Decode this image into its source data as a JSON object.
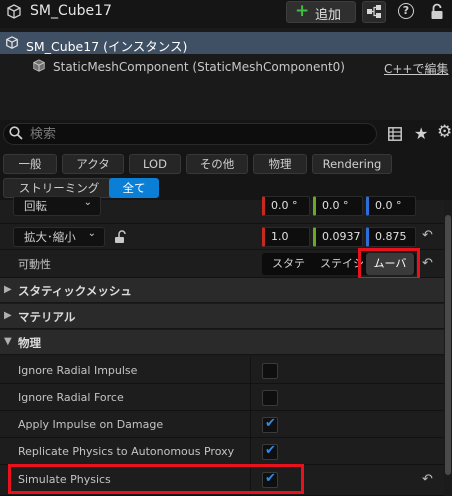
{
  "header": {
    "actor_name": "SM_Cube17",
    "add_label": "追加",
    "help_label": "?"
  },
  "tree": {
    "selected_label": "SM_Cube17 (インスタンス)",
    "component_label": "StaticMeshComponent (StaticMeshComponent0)",
    "edit_cpp_label": "C++で編集"
  },
  "search": {
    "placeholder": "検索"
  },
  "filters": [
    "一般",
    "アクタ",
    "LOD",
    "その他",
    "物理",
    "Rendering",
    "ストリーミング",
    "全て"
  ],
  "active_filter": "全て",
  "transform": {
    "rotation_label": "回転",
    "rotation": {
      "x": "0.0 °",
      "y": "0.0 °",
      "z": "0.0 °"
    },
    "scale_label": "拡大･縮小",
    "scale": {
      "x": "1.0",
      "y": "0.0937",
      "z": "0.875"
    }
  },
  "mobility": {
    "label": "可動性",
    "options": [
      "スタティック",
      "ステイショナリー",
      "ムーバブル"
    ],
    "selected": "ムーバブル",
    "visible": [
      "スタテ",
      "ステイシ",
      "ムーバ"
    ]
  },
  "categories": {
    "static_mesh": "スタティックメッシュ",
    "material": "マテリアル",
    "physics": "物理"
  },
  "physics": [
    {
      "label": "Ignore Radial Impulse",
      "checked": false
    },
    {
      "label": "Ignore Radial Force",
      "checked": false
    },
    {
      "label": "Apply Impulse on Damage",
      "checked": true
    },
    {
      "label": "Replicate Physics to Autonomous Proxy",
      "checked": true
    },
    {
      "label": "Simulate Physics",
      "checked": true
    }
  ],
  "colors": {
    "accent": "#0b7ed6",
    "selection": "#3f4f64",
    "highlight": "#e8121c",
    "add_plus": "#3ebd3e"
  }
}
